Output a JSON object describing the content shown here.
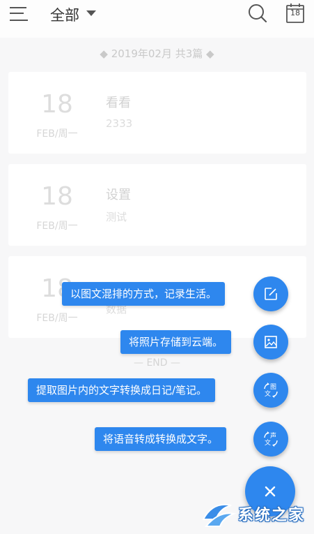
{
  "header": {
    "title": "全部",
    "calendar_day": "18"
  },
  "month_header": "◆ 2019年02月 共3篇 ◆",
  "entries": [
    {
      "day": "18",
      "month": "FEB/周一",
      "title": "看看",
      "desc": "2333"
    },
    {
      "day": "18",
      "month": "FEB/周一",
      "title": "设置",
      "desc": "测试"
    },
    {
      "day": "18",
      "month": "FEB/周一",
      "title": "",
      "desc": "数据"
    }
  ],
  "end_label": "— END —",
  "fab_menu": [
    {
      "label": "以图文混排的方式，记录生活。",
      "icon": "edit-icon"
    },
    {
      "label": "将照片存储到云端。",
      "icon": "image-icon"
    },
    {
      "label": "提取图片内的文字转换成日记/笔记。",
      "icon": "image-to-text-icon",
      "icon_text_top": "图",
      "icon_text_bottom": "文"
    },
    {
      "label": "将语音转成转换成文字。",
      "icon": "voice-to-text-icon",
      "icon_text_top": "声",
      "icon_text_bottom": "文"
    }
  ],
  "watermark": "系统之家",
  "colors": {
    "accent": "#2e87ee",
    "background": "#f7f7f8"
  }
}
